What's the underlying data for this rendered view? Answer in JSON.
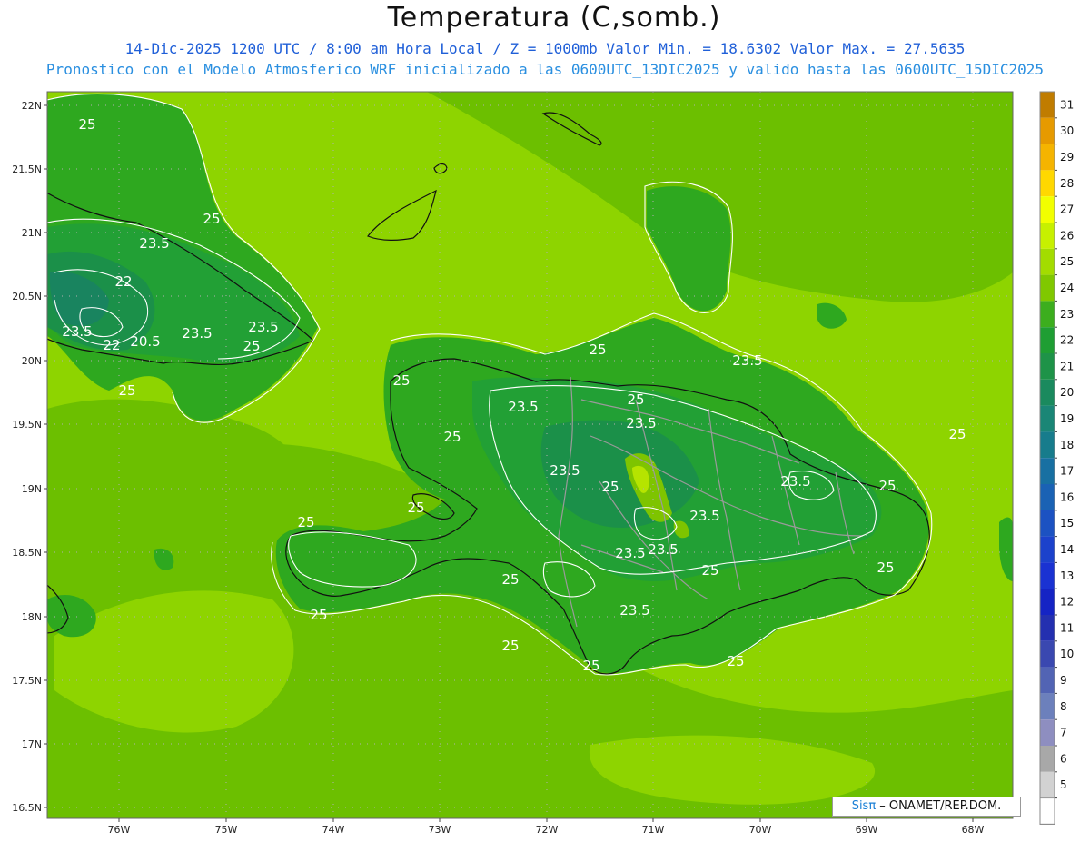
{
  "title": "Temperatura (C,somb.)",
  "subtitle_line1": "14-Dic-2025  1200 UTC / 8:00 am Hora Local / Z = 1000mb   Valor Min. = 18.6302  Valor Max. = 27.5635",
  "subtitle_line2": "Pronostico con el Modelo Atmosferico WRF inicializado a las 0600UTC_13DIC2025 y valido hasta las  0600UTC_15DIC2025",
  "credit": {
    "brand": "Sisπ",
    "text": " – ONAMET/REP.DOM."
  },
  "lat_labels": [
    "22N",
    "21.5N",
    "21N",
    "20.5N",
    "20N",
    "19.5N",
    "19N",
    "18.5N",
    "18N",
    "17.5N",
    "17N",
    "16.5N"
  ],
  "lon_labels": [
    "76W",
    "75W",
    "74W",
    "73W",
    "72W",
    "71W",
    "70W",
    "69W",
    "68W"
  ],
  "colorbar": {
    "levels": [
      "31",
      "30",
      "29",
      "28",
      "27",
      "26",
      "25",
      "24",
      "23",
      "22",
      "21",
      "20",
      "19",
      "18",
      "17",
      "16",
      "15",
      "14",
      "13",
      "12",
      "11",
      "10",
      "9",
      "8",
      "7",
      "6",
      "5"
    ],
    "colors": [
      "#c07c00",
      "#e69a00",
      "#f5b400",
      "#ffd800",
      "#f2ff00",
      "#c7f000",
      "#a3dc00",
      "#80c800",
      "#3cae1e",
      "#1f9e33",
      "#1e9348",
      "#1a8a5e",
      "#1a8676",
      "#177c8c",
      "#1870a2",
      "#1a62b4",
      "#1c52c2",
      "#1c42cc",
      "#1a32d2",
      "#1524c4",
      "#2430b0",
      "#3a48b0",
      "#5264b4",
      "#6c80bc",
      "#8e8ec0",
      "#a8a8a8",
      "#d2d2d2"
    ],
    "bottom_color": "#ffffff"
  },
  "fill_colors": {
    "sea_light": "#8ed400",
    "sea_mid": "#6cbf00",
    "land_24": "#2ea81f",
    "land_23": "#22a035",
    "land_22": "#1b9049",
    "land_21": "#19845f",
    "mountain_25": "#7ec400",
    "mountain_26": "#b6e400"
  },
  "contour_labels": [
    "25",
    "25",
    "23.5",
    "22",
    "23.5",
    "22",
    "20.5",
    "23.5",
    "23.5",
    "25",
    "25",
    "25",
    "25",
    "23.5",
    "23.5",
    "25",
    "23.5",
    "25",
    "23.5",
    "25",
    "25",
    "25",
    "23.5",
    "23.5",
    "25",
    "25",
    "23.5",
    "23.5",
    "25",
    "25",
    "23.5",
    "25",
    "25",
    "25",
    "25",
    "25"
  ]
}
